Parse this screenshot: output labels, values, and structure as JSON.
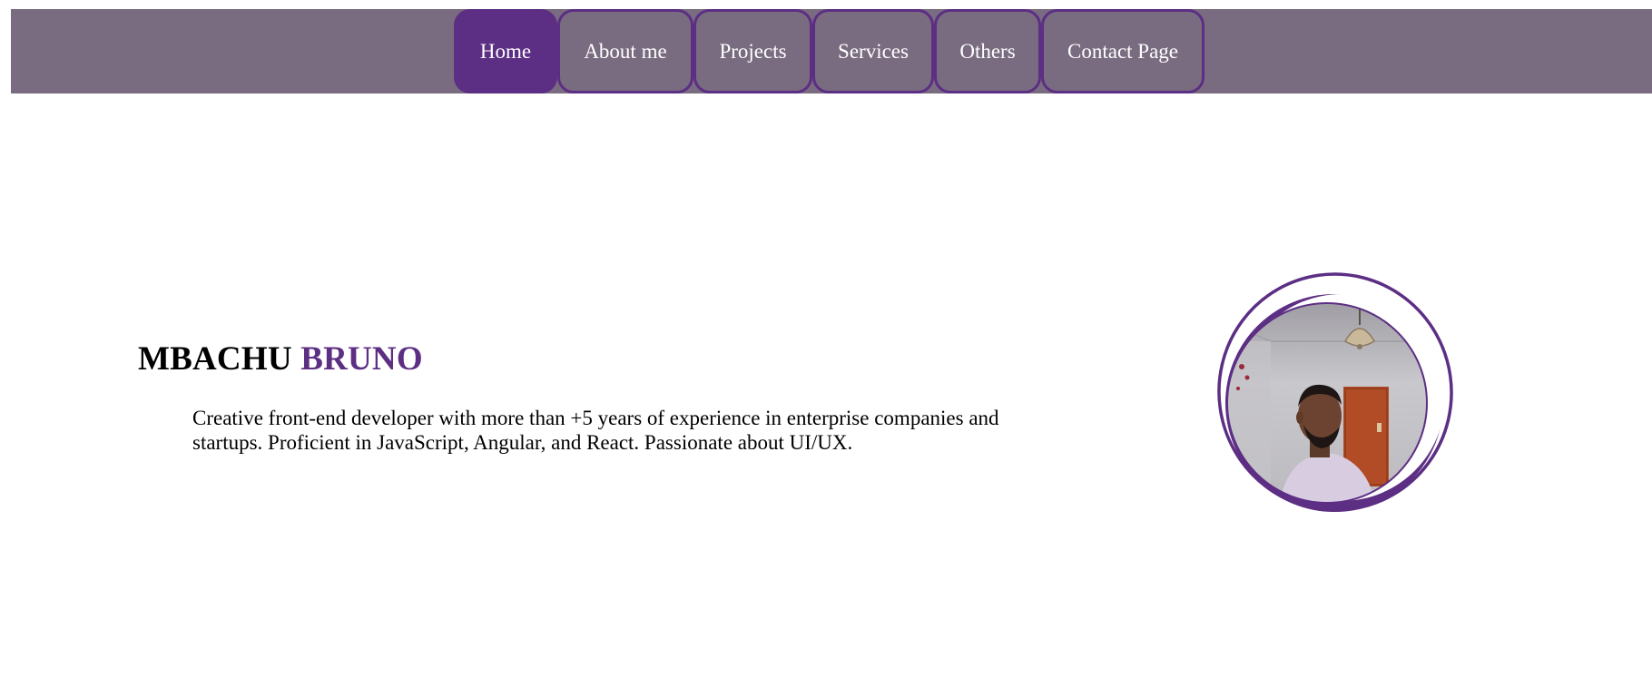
{
  "nav": {
    "items": [
      {
        "label": "Home",
        "active": true
      },
      {
        "label": "About me",
        "active": false
      },
      {
        "label": "Projects",
        "active": false
      },
      {
        "label": "Services",
        "active": false
      },
      {
        "label": "Others",
        "active": false
      },
      {
        "label": "Contact Page",
        "active": false
      }
    ]
  },
  "hero": {
    "first_name": "MBACHU",
    "last_name": "BRUNO",
    "description": "Creative front-end developer with more than +5 years of experience in enterprise companies and startups. Proficient in JavaScript, Angular, and React. Passionate about UI/UX."
  },
  "colors": {
    "accent": "#5c2e84",
    "nav_background": "#7a6c80",
    "text": "#000000",
    "nav_text": "#ffffff"
  }
}
